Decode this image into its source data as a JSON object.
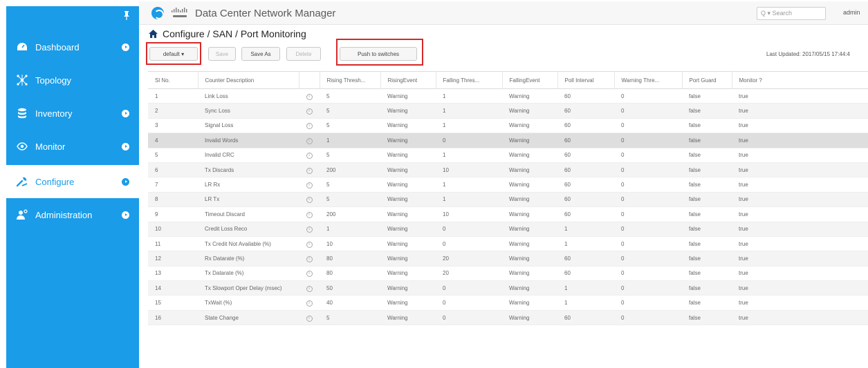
{
  "app": {
    "title": "Data Center Network Manager"
  },
  "search": {
    "placeholder": "Search",
    "prefix": "Q ▾"
  },
  "user": {
    "name": "admin"
  },
  "sidebar": {
    "items": [
      {
        "label": "Dashboard",
        "icon": "dashboard-icon"
      },
      {
        "label": "Topology",
        "icon": "topology-icon"
      },
      {
        "label": "Inventory",
        "icon": "database-icon"
      },
      {
        "label": "Monitor",
        "icon": "eye-icon"
      },
      {
        "label": "Configure",
        "icon": "wrench-icon",
        "active": true
      },
      {
        "label": "Administration",
        "icon": "admin-user-icon"
      }
    ]
  },
  "breadcrumb": {
    "path": "Configure / SAN / Port Monitoring"
  },
  "toolbar": {
    "policy_label": "default ▾",
    "save_label": "Save",
    "save_as_label": "Save As",
    "delete_label": "Delete",
    "push_label": "Push to switches",
    "last_updated": "Last Updated: 2017/05/15 17:44:4"
  },
  "table": {
    "columns": [
      "Sl No.",
      "Counter Description",
      "",
      "Rising Thresh...",
      "RisingEvent",
      "Falling Thres...",
      "FallingEvent",
      "Poll Interval",
      "Warning Thre...",
      "Port Guard",
      "Monitor ?"
    ],
    "rows": [
      [
        "1",
        "Link Loss",
        "5",
        "Warning",
        "1",
        "Warning",
        "60",
        "0",
        "false",
        "true"
      ],
      [
        "2",
        "Sync Loss",
        "5",
        "Warning",
        "1",
        "Warning",
        "60",
        "0",
        "false",
        "true"
      ],
      [
        "3",
        "Signal Loss",
        "5",
        "Warning",
        "1",
        "Warning",
        "60",
        "0",
        "false",
        "true"
      ],
      [
        "4",
        "Invalid Words",
        "1",
        "Warning",
        "0",
        "Warning",
        "60",
        "0",
        "false",
        "true"
      ],
      [
        "5",
        "Invalid CRC",
        "5",
        "Warning",
        "1",
        "Warning",
        "60",
        "0",
        "false",
        "true"
      ],
      [
        "6",
        "Tx Discards",
        "200",
        "Warning",
        "10",
        "Warning",
        "60",
        "0",
        "false",
        "true"
      ],
      [
        "7",
        "LR Rx",
        "5",
        "Warning",
        "1",
        "Warning",
        "60",
        "0",
        "false",
        "true"
      ],
      [
        "8",
        "LR Tx",
        "5",
        "Warning",
        "1",
        "Warning",
        "60",
        "0",
        "false",
        "true"
      ],
      [
        "9",
        "Timeout Discard",
        "200",
        "Warning",
        "10",
        "Warning",
        "60",
        "0",
        "false",
        "true"
      ],
      [
        "10",
        "Credit Loss Reco",
        "1",
        "Warning",
        "0",
        "Warning",
        "1",
        "0",
        "false",
        "true"
      ],
      [
        "11",
        "Tx Credit Not Available (%)",
        "10",
        "Warning",
        "0",
        "Warning",
        "1",
        "0",
        "false",
        "true"
      ],
      [
        "12",
        "Rx Datarate (%)",
        "80",
        "Warning",
        "20",
        "Warning",
        "60",
        "0",
        "false",
        "true"
      ],
      [
        "13",
        "Tx Datarate (%)",
        "80",
        "Warning",
        "20",
        "Warning",
        "60",
        "0",
        "false",
        "true"
      ],
      [
        "14",
        "Tx Slowport Oper Delay (msec)",
        "50",
        "Warning",
        "0",
        "Warning",
        "1",
        "0",
        "false",
        "true"
      ],
      [
        "15",
        "TxWait (%)",
        "40",
        "Warning",
        "0",
        "Warning",
        "1",
        "0",
        "false",
        "true"
      ],
      [
        "16",
        "State Change",
        "5",
        "Warning",
        "0",
        "Warning",
        "60",
        "0",
        "false",
        "true"
      ]
    ],
    "selected_row": 3
  },
  "colors": {
    "accent": "#1a9ce8",
    "highlight": "#d62828"
  }
}
